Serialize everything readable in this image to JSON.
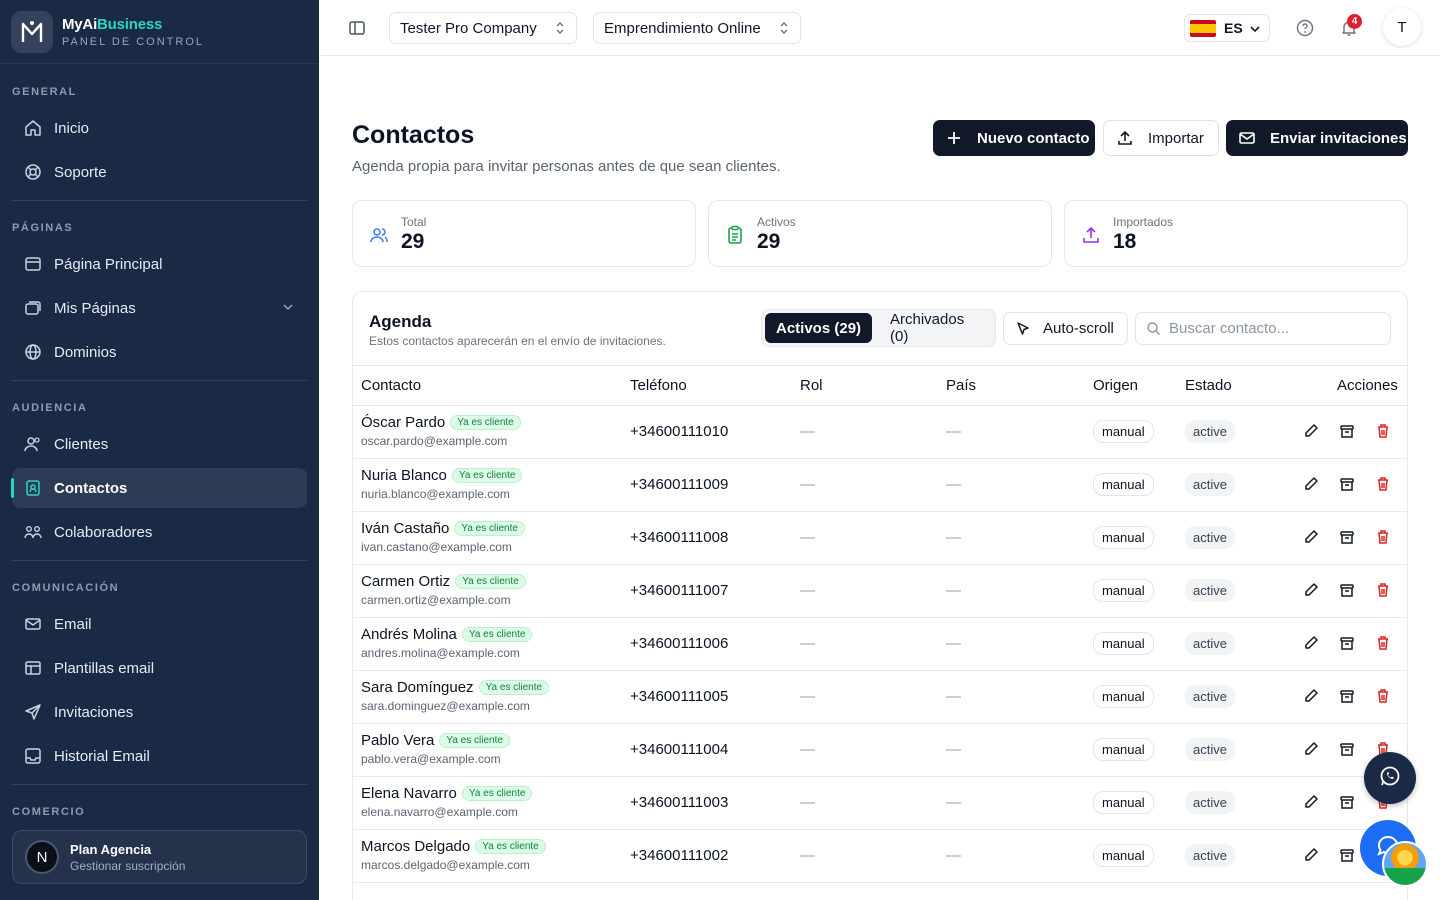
{
  "brand": {
    "name_main": "MyAi",
    "name_accent": "Business",
    "subtitle": "PANEL DE CONTROL"
  },
  "sidebar": {
    "sections": [
      {
        "title": "GENERAL",
        "items": [
          {
            "label": "Inicio",
            "icon": "home-icon"
          },
          {
            "label": "Soporte",
            "icon": "lifebuoy-icon"
          }
        ]
      },
      {
        "title": "PÁGINAS",
        "items": [
          {
            "label": "Página Principal",
            "icon": "window-icon"
          },
          {
            "label": "Mis Páginas",
            "icon": "pages-icon"
          },
          {
            "label": "Dominios",
            "icon": "globe-icon"
          }
        ]
      },
      {
        "title": "AUDIENCIA",
        "items": [
          {
            "label": "Clientes",
            "icon": "users-icon"
          },
          {
            "label": "Contactos",
            "icon": "contact-book-icon",
            "active": true
          },
          {
            "label": "Colaboradores",
            "icon": "team-icon"
          }
        ]
      },
      {
        "title": "COMUNICACIÓN",
        "items": [
          {
            "label": "Email",
            "icon": "mail-icon"
          },
          {
            "label": "Plantillas email",
            "icon": "template-icon"
          },
          {
            "label": "Invitaciones",
            "icon": "send-icon"
          },
          {
            "label": "Historial Email",
            "icon": "inbox-icon"
          }
        ]
      },
      {
        "title": "COMERCIO",
        "items": []
      }
    ],
    "plan": {
      "avatar": "N",
      "title": "Plan Agencia",
      "subtitle": "Gestionar suscripción"
    }
  },
  "topbar": {
    "company": "Tester Pro Company",
    "project": "Emprendimiento Online",
    "language": "ES",
    "notifications": "4",
    "user_initial": "T"
  },
  "header": {
    "title": "Contactos",
    "subtitle": "Agenda propia para invitar personas antes de que sean clientes.",
    "buttons": {
      "new": "Nuevo contacto",
      "import": "Importar",
      "invite": "Enviar invitaciones"
    }
  },
  "stats": [
    {
      "label": "Total",
      "value": "29"
    },
    {
      "label": "Activos",
      "value": "29"
    },
    {
      "label": "Importados",
      "value": "18"
    }
  ],
  "agenda": {
    "title": "Agenda",
    "subtitle": "Estos contactos aparecerán en el envío de invitaciones.",
    "tab_active": "Activos (29)",
    "tab_archived": "Archivados (0)",
    "autoscroll": "Auto-scroll",
    "search_placeholder": "Buscar contacto...",
    "columns": [
      "Contacto",
      "Teléfono",
      "Rol",
      "País",
      "Origen",
      "Estado",
      "Acciones"
    ],
    "client_tag": "Ya es cliente",
    "empty": "—",
    "rows": [
      {
        "name": "Óscar Pardo",
        "email": "oscar.pardo@example.com",
        "phone": "+34600111010",
        "origin": "manual",
        "status": "active"
      },
      {
        "name": "Nuria Blanco",
        "email": "nuria.blanco@example.com",
        "phone": "+34600111009",
        "origin": "manual",
        "status": "active"
      },
      {
        "name": "Iván Castaño",
        "email": "ivan.castano@example.com",
        "phone": "+34600111008",
        "origin": "manual",
        "status": "active"
      },
      {
        "name": "Carmen Ortiz",
        "email": "carmen.ortiz@example.com",
        "phone": "+34600111007",
        "origin": "manual",
        "status": "active"
      },
      {
        "name": "Andrés Molina",
        "email": "andres.molina@example.com",
        "phone": "+34600111006",
        "origin": "manual",
        "status": "active"
      },
      {
        "name": "Sara Domínguez",
        "email": "sara.dominguez@example.com",
        "phone": "+34600111005",
        "origin": "manual",
        "status": "active"
      },
      {
        "name": "Pablo Vera",
        "email": "pablo.vera@example.com",
        "phone": "+34600111004",
        "origin": "manual",
        "status": "active"
      },
      {
        "name": "Elena Navarro",
        "email": "elena.navarro@example.com",
        "phone": "+34600111003",
        "origin": "manual",
        "status": "active"
      },
      {
        "name": "Marcos Delgado",
        "email": "marcos.delgado@example.com",
        "phone": "+34600111002",
        "origin": "manual",
        "status": "active"
      }
    ]
  },
  "colors": {
    "sidebar": "#1b2a44",
    "accent": "#2dd4bf",
    "primary_button": "#111827",
    "danger": "#dc2626",
    "tag_green": "#15803d"
  }
}
